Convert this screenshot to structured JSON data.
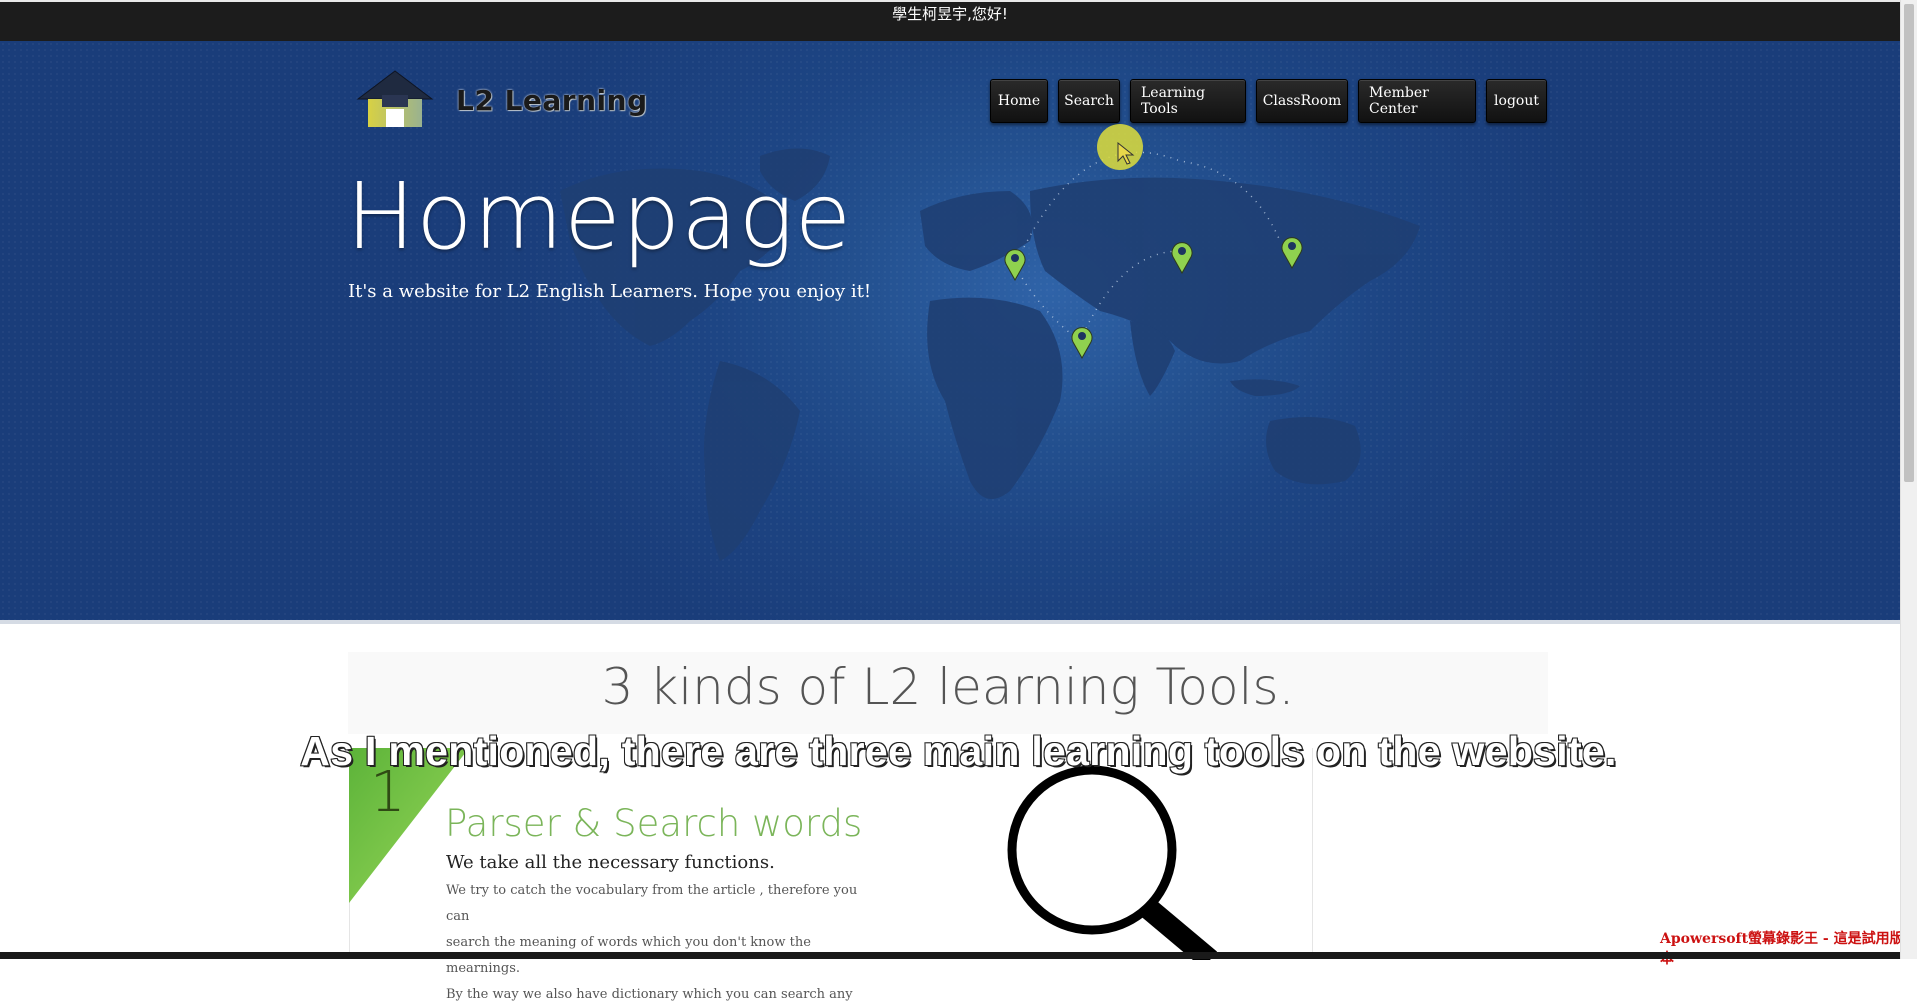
{
  "greeting": "學生柯昱宇,您好!",
  "logo": {
    "text": "L2 Learning",
    "icon": "graduation-house-icon"
  },
  "nav": {
    "items": [
      {
        "label": "Home"
      },
      {
        "label": "Search"
      },
      {
        "label": "Learning Tools"
      },
      {
        "label": "ClassRoom"
      },
      {
        "label": "Member Center"
      },
      {
        "label": "logout"
      }
    ]
  },
  "hero": {
    "title": "Homepage",
    "subtitle": "It's a website for L2 English Learners. Hope you enjoy it!",
    "icons": [
      "world-map-icon",
      "map-pin-icon"
    ]
  },
  "section": {
    "title": "3 kinds of L2 learning Tools."
  },
  "card": {
    "number": "1",
    "title": "Parser & Search words",
    "subtitle": "We take all the necessary functions.",
    "body_lines": [
      "We try to catch the vocabulary from the article , therefore you can",
      "search the meaning of words which you don't know the mearnings.",
      "By the way we also have dictionary which you can search any"
    ],
    "icon": "magnifier-icon"
  },
  "caption": "As I mentioned, there are three main learning tools on the website.",
  "watermark": "Apowersoft螢幕錄影王 - 這是試用版本",
  "colors": {
    "hero_bg": "#1d4584",
    "nav_bg": "#1a1a1a",
    "accent_green": "#7bb55a",
    "pin_green": "#8fd14f",
    "watermark": "#cc1111"
  }
}
